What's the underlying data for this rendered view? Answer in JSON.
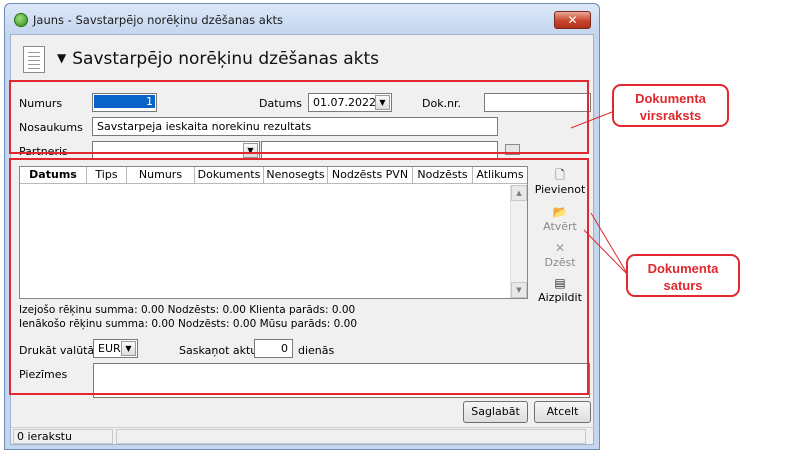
{
  "window": {
    "title": "Jauns - Savstarpējo norēķinu dzēšanas akts",
    "close_glyph": "✕"
  },
  "header": {
    "title": "Savstarpējo norēķinu dzēšanas akts",
    "arrow": "▼"
  },
  "form": {
    "numurs_label": "Numurs",
    "numurs_value": "1",
    "datums_label": "Datums",
    "datums_value": "01.07.2022",
    "doknr_label": "Dok.nr.",
    "doknr_value": "",
    "nosaukums_label": "Nosaukums",
    "nosaukums_value": "Savstarpeja ieskaita norekinu rezultats",
    "partneris_label": "Partneris",
    "partneris_value": "",
    "partneris_name": ""
  },
  "grid": {
    "columns": [
      "Datums",
      "Tips",
      "Numurs",
      "Dokuments",
      "Nenosegts",
      "Nodzēsts PVN",
      "Nodzēsts",
      "Atlikums"
    ],
    "rows": []
  },
  "side_buttons": {
    "add": "Pievienot",
    "open": "Atvērt",
    "delete": "Dzēst",
    "fill": "Aizpildit"
  },
  "summary": {
    "outgoing": "Izejošo rēķinu summa: 0.00 Nodzēsts: 0.00 Klienta parāds: 0.00",
    "incoming": "Ienākošo rēķinu summa: 0.00 Nodzēsts: 0.00 Mūsu parāds: 0.00"
  },
  "print": {
    "currency_label": "Drukāt valūtā",
    "currency_value": "EUR",
    "agree_label": "Saskaņot aktu",
    "agree_value": "0",
    "days_label": "dienās"
  },
  "notes": {
    "label": "Piezīmes",
    "value": ""
  },
  "buttons": {
    "save": "Saglabāt",
    "cancel": "Atcelt"
  },
  "status": {
    "count": "0 ierakstu"
  },
  "annotations": {
    "header_callout": "Dokumenta virsraksts",
    "content_callout": "Dokumenta saturs"
  },
  "colors": {
    "annotation_red": "#e0282e",
    "title_bar": "#c4d6ee",
    "close_button": "#c7452c"
  }
}
